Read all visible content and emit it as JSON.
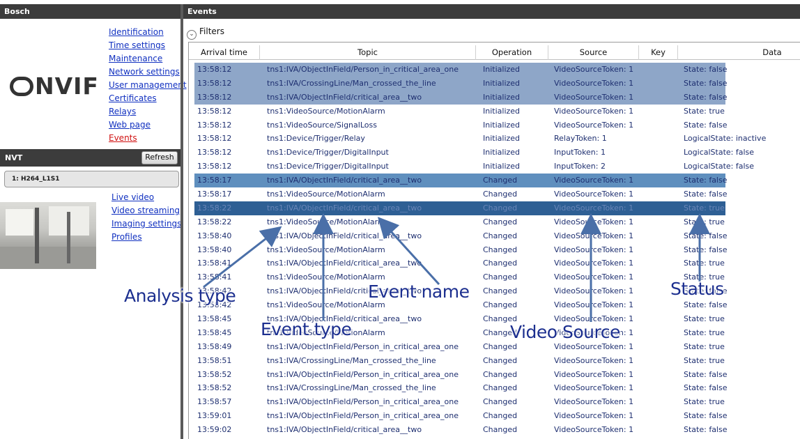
{
  "left_panel": {
    "title": "Bosch",
    "logo_text": "NVIF",
    "menu": [
      {
        "label": "Identification",
        "active": false
      },
      {
        "label": "Time settings",
        "active": false
      },
      {
        "label": "Maintenance",
        "active": false
      },
      {
        "label": "Network settings",
        "active": false
      },
      {
        "label": "User management",
        "active": false
      },
      {
        "label": "Certificates",
        "active": false
      },
      {
        "label": "Relays",
        "active": false
      },
      {
        "label": "Web page",
        "active": false
      },
      {
        "label": "Events",
        "active": true
      }
    ],
    "nvt": {
      "title": "NVT",
      "refresh_label": "Refresh"
    },
    "profile": "1: H264_L1S1",
    "video_menu": [
      "Live video",
      "Video streaming",
      "Imaging settings",
      "Profiles"
    ]
  },
  "right_panel": {
    "title": "Events",
    "filters_label": "Filters",
    "columns": [
      "Arrival time",
      "Topic",
      "Operation",
      "Source",
      "Key",
      "Data"
    ],
    "rows": [
      {
        "time": "13:58:12",
        "topic": "tns1:IVA/ObjectInField/Person_in_critical_area_one",
        "op": "Initialized",
        "src": "VideoSourceToken: 1",
        "data": "State: false",
        "hl": "sel"
      },
      {
        "time": "13:58:12",
        "topic": "tns1:IVA/CrossingLine/Man_crossed_the_line",
        "op": "Initialized",
        "src": "VideoSourceToken: 1",
        "data": "State: false",
        "hl": "sel"
      },
      {
        "time": "13:58:12",
        "topic": "tns1:IVA/ObjectInField/critical_area__two",
        "op": "Initialized",
        "src": "VideoSourceToken: 1",
        "data": "State: false",
        "hl": "sel"
      },
      {
        "time": "13:58:12",
        "topic": "tns1:VideoSource/MotionAlarm",
        "op": "Initialized",
        "src": "VideoSourceToken: 1",
        "data": "State: true",
        "hl": ""
      },
      {
        "time": "13:58:12",
        "topic": "tns1:VideoSource/SignalLoss",
        "op": "Initialized",
        "src": "VideoSourceToken: 1",
        "data": "State: false",
        "hl": ""
      },
      {
        "time": "13:58:12",
        "topic": "tns1:Device/Trigger/Relay",
        "op": "Initialized",
        "src": "RelayToken: 1",
        "data": "LogicalState: inactive",
        "hl": ""
      },
      {
        "time": "13:58:12",
        "topic": "tns1:Device/Trigger/DigitalInput",
        "op": "Initialized",
        "src": "InputToken: 1",
        "data": "LogicalState: false",
        "hl": ""
      },
      {
        "time": "13:58:12",
        "topic": "tns1:Device/Trigger/DigitalInput",
        "op": "Initialized",
        "src": "InputToken: 2",
        "data": "LogicalState: false",
        "hl": ""
      },
      {
        "time": "13:58:17",
        "topic": "tns1:IVA/ObjectInField/critical_area__two",
        "op": "Changed",
        "src": "VideoSourceToken: 1",
        "data": "State: false",
        "hl": "sel2"
      },
      {
        "time": "13:58:17",
        "topic": "tns1:VideoSource/MotionAlarm",
        "op": "Changed",
        "src": "VideoSourceToken: 1",
        "data": "State: false",
        "hl": ""
      },
      {
        "time": "13:58:22",
        "topic": "tns1:IVA/ObjectInField/critical_area__two",
        "op": "Changed",
        "src": "VideoSourceToken: 1",
        "data": "State: true",
        "hl": "sel3"
      },
      {
        "time": "13:58:22",
        "topic": "tns1:VideoSource/MotionAlarm",
        "op": "Changed",
        "src": "VideoSourceToken: 1",
        "data": "State: true",
        "hl": ""
      },
      {
        "time": "13:58:40",
        "topic": "tns1:IVA/ObjectInField/critical_area__two",
        "op": "Changed",
        "src": "VideoSourceToken: 1",
        "data": "State: false",
        "hl": ""
      },
      {
        "time": "13:58:40",
        "topic": "tns1:VideoSource/MotionAlarm",
        "op": "Changed",
        "src": "VideoSourceToken: 1",
        "data": "State: false",
        "hl": ""
      },
      {
        "time": "13:58:41",
        "topic": "tns1:IVA/ObjectInField/critical_area__two",
        "op": "Changed",
        "src": "VideoSourceToken: 1",
        "data": "State: true",
        "hl": ""
      },
      {
        "time": "13:58:41",
        "topic": "tns1:VideoSource/MotionAlarm",
        "op": "Changed",
        "src": "VideoSourceToken: 1",
        "data": "State: true",
        "hl": ""
      },
      {
        "time": "13:58:42",
        "topic": "tns1:IVA/ObjectInField/critical_area__two",
        "op": "Changed",
        "src": "VideoSourceToken: 1",
        "data": "State: false",
        "hl": ""
      },
      {
        "time": "13:58:42",
        "topic": "tns1:VideoSource/MotionAlarm",
        "op": "Changed",
        "src": "VideoSourceToken: 1",
        "data": "State: false",
        "hl": ""
      },
      {
        "time": "13:58:45",
        "topic": "tns1:IVA/ObjectInField/critical_area__two",
        "op": "Changed",
        "src": "VideoSourceToken: 1",
        "data": "State: true",
        "hl": ""
      },
      {
        "time": "13:58:45",
        "topic": "tns1:VideoSource/MotionAlarm",
        "op": "Changed",
        "src": "VideoSourceToken: 1",
        "data": "State: true",
        "hl": ""
      },
      {
        "time": "13:58:49",
        "topic": "tns1:IVA/ObjectInField/Person_in_critical_area_one",
        "op": "Changed",
        "src": "VideoSourceToken: 1",
        "data": "State: true",
        "hl": ""
      },
      {
        "time": "13:58:51",
        "topic": "tns1:IVA/CrossingLine/Man_crossed_the_line",
        "op": "Changed",
        "src": "VideoSourceToken: 1",
        "data": "State: true",
        "hl": ""
      },
      {
        "time": "13:58:52",
        "topic": "tns1:IVA/ObjectInField/Person_in_critical_area_one",
        "op": "Changed",
        "src": "VideoSourceToken: 1",
        "data": "State: false",
        "hl": ""
      },
      {
        "time": "13:58:52",
        "topic": "tns1:IVA/CrossingLine/Man_crossed_the_line",
        "op": "Changed",
        "src": "VideoSourceToken: 1",
        "data": "State: false",
        "hl": ""
      },
      {
        "time": "13:58:57",
        "topic": "tns1:IVA/ObjectInField/Person_in_critical_area_one",
        "op": "Changed",
        "src": "VideoSourceToken: 1",
        "data": "State: true",
        "hl": ""
      },
      {
        "time": "13:59:01",
        "topic": "tns1:IVA/ObjectInField/Person_in_critical_area_one",
        "op": "Changed",
        "src": "VideoSourceToken: 1",
        "data": "State: false",
        "hl": ""
      },
      {
        "time": "13:59:02",
        "topic": "tns1:IVA/ObjectInField/critical_area__two",
        "op": "Changed",
        "src": "VideoSourceToken: 1",
        "data": "State: false",
        "hl": ""
      }
    ]
  },
  "annotations": {
    "analysis_type": "Analysis type",
    "event_type": "Event type",
    "event_name": "Event name",
    "video_source": "Video Source",
    "status": "Status"
  },
  "colors": {
    "header_bg": "#3c3c3c",
    "link": "#1030c0",
    "active_link": "#d01010",
    "selection_light": "#8ea6c8",
    "selection_mid": "#5f8fbe",
    "selection_dark": "#2e5f94",
    "annotation": "#1c2f8f"
  }
}
